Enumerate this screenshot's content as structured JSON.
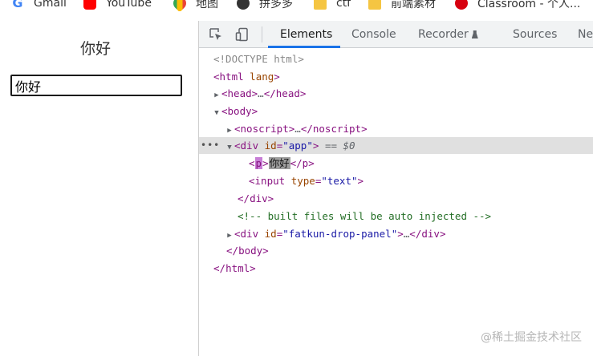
{
  "bookmarks": [
    {
      "label": "Gmail",
      "icon": "google-icon"
    },
    {
      "label": "YouTube",
      "icon": "youtube-icon"
    },
    {
      "label": "地图",
      "icon": "maps-icon"
    },
    {
      "label": "拼多多",
      "icon": "pinduoduo-icon"
    },
    {
      "label": "ctf",
      "icon": "folder-icon"
    },
    {
      "label": "前端素材",
      "icon": "folder-icon"
    },
    {
      "label": "Classroom - 个人...",
      "icon": "huawei-icon"
    }
  ],
  "page": {
    "paragraph": "你好",
    "input_value": "你好"
  },
  "devtools": {
    "tabs": [
      "Elements",
      "Console",
      "Recorder",
      "Sources",
      "Ne"
    ],
    "active_tab": "Elements",
    "dom": {
      "doctype": "<!DOCTYPE html>",
      "html_open": "html",
      "html_attr": "lang",
      "head": "head",
      "body": "body",
      "noscript": "noscript",
      "div": "div",
      "id_attr": "id",
      "app_value": "\"app\"",
      "selected_marker": "== $0",
      "p_tag": "p",
      "p_text": "你好",
      "input_tag": "input",
      "type_attr": "type",
      "type_value": "\"text\"",
      "comment": "<!-- built files will be auto injected -->",
      "fatkun_value": "\"fatkun-drop-panel\"",
      "ellipsis": "…",
      "html_close": "html"
    }
  },
  "watermark": "@稀土掘金技术社区",
  "colors": {
    "tab_underline": "#1a73e8",
    "tag": "#881280",
    "attr": "#994500",
    "value": "#1a1aa6",
    "comment": "#236e25"
  }
}
